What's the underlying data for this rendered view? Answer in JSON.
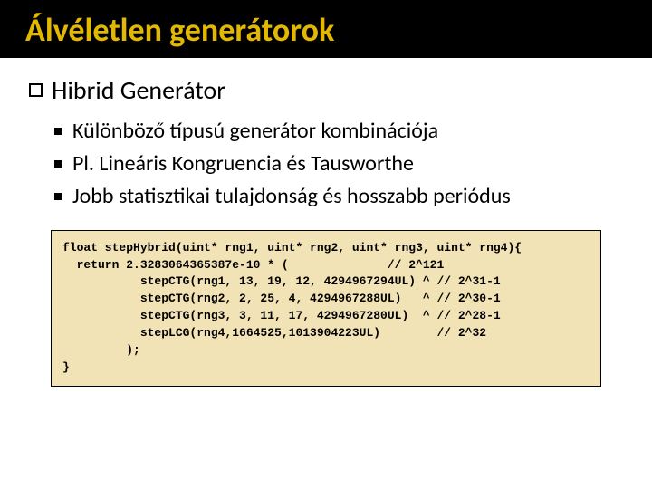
{
  "title": "Álvéletlen generátorok",
  "heading": "Hibrid Generátor",
  "bullets": [
    "Különböző típusú generátor kombinációja",
    "Pl. Lineáris Kongruencia és Tausworthe",
    "Jobb statisztikai tulajdonság és hosszabb periódus"
  ],
  "code": "float stepHybrid(uint* rng1, uint* rng2, uint* rng3, uint* rng4){\n  return 2.3283064365387e-10 * (              // 2^121\n           stepCTG(rng1, 13, 19, 12, 4294967294UL) ^ // 2^31-1\n           stepCTG(rng2, 2, 25, 4, 4294967288UL)   ^ // 2^30-1\n           stepCTG(rng3, 3, 11, 17, 4294967280UL)  ^ // 2^28-1\n           stepLCG(rng4,1664525,1013904223UL)        // 2^32\n         );\n}"
}
